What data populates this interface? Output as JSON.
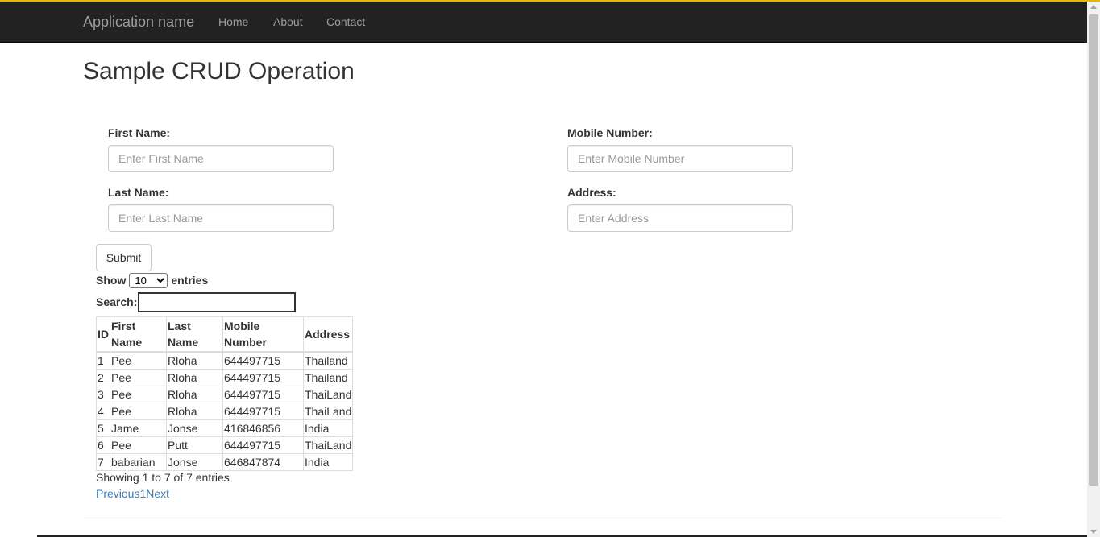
{
  "navbar": {
    "brand": "Application name",
    "links": [
      {
        "label": "Home"
      },
      {
        "label": "About"
      },
      {
        "label": "Contact"
      }
    ]
  },
  "page": {
    "title": "Sample CRUD Operation"
  },
  "form": {
    "first_name": {
      "label": "First Name:",
      "placeholder": "Enter First Name",
      "value": ""
    },
    "last_name": {
      "label": "Last Name:",
      "placeholder": "Enter Last Name",
      "value": ""
    },
    "mobile": {
      "label": "Mobile Number:",
      "placeholder": "Enter Mobile Number",
      "value": ""
    },
    "address": {
      "label": "Address:",
      "placeholder": "Enter Address",
      "value": ""
    },
    "submit_label": "Submit"
  },
  "table_controls": {
    "show_label": "Show",
    "entries_label": "entries",
    "length_selected": "10",
    "search_label": "Search:",
    "search_value": ""
  },
  "table": {
    "headers": {
      "id": "ID",
      "first_name": "First Name",
      "last_name": "Last Name",
      "mobile": "Mobile Number",
      "address": "Address"
    },
    "rows": [
      {
        "id": "1",
        "first_name": "Pee",
        "last_name": "Rloha",
        "mobile": "644497715",
        "address": "Thailand"
      },
      {
        "id": "2",
        "first_name": "Pee",
        "last_name": "Rloha",
        "mobile": "644497715",
        "address": "Thailand"
      },
      {
        "id": "3",
        "first_name": "Pee",
        "last_name": "Rloha",
        "mobile": "644497715",
        "address": "ThaiLand"
      },
      {
        "id": "4",
        "first_name": "Pee",
        "last_name": "Rloha",
        "mobile": "644497715",
        "address": "ThaiLand"
      },
      {
        "id": "5",
        "first_name": "Jame",
        "last_name": "Jonse",
        "mobile": "416846856",
        "address": "India"
      },
      {
        "id": "6",
        "first_name": "Pee",
        "last_name": "Putt",
        "mobile": "644497715",
        "address": "ThaiLand"
      },
      {
        "id": "7",
        "first_name": "babarian",
        "last_name": "Jonse",
        "mobile": "646847874",
        "address": "India"
      }
    ]
  },
  "pagination": {
    "info": "Showing 1 to 7 of 7 entries",
    "previous": "Previous",
    "page": "1",
    "next": "Next"
  },
  "colors": {
    "navbar_bg": "#222222",
    "top_accent": "#f0b400",
    "link": "#337ab7"
  }
}
